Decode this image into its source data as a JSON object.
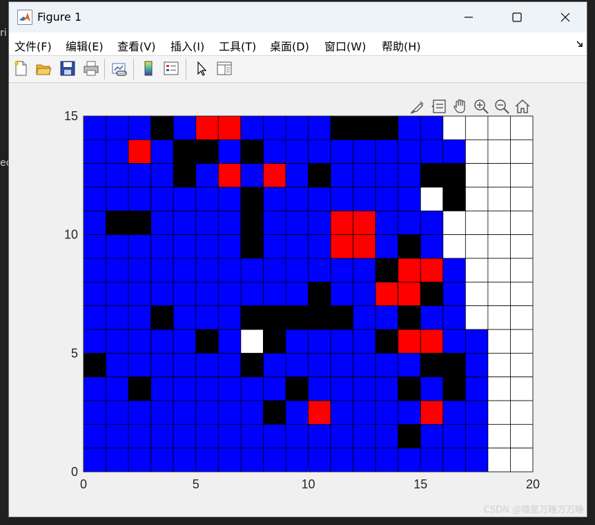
{
  "window": {
    "title": "Figure 1",
    "side_text_1": "ri",
    "side_text_2": "ec"
  },
  "menu": [
    {
      "label": "文件(F)"
    },
    {
      "label": "编辑(E)"
    },
    {
      "label": "查看(V)"
    },
    {
      "label": "插入(I)"
    },
    {
      "label": "工具(T)"
    },
    {
      "label": "桌面(D)"
    },
    {
      "label": "窗口(W)"
    },
    {
      "label": "帮助(H)"
    }
  ],
  "toolbar": [
    "new-figure-icon",
    "open-file-icon",
    "save-icon",
    "print-icon",
    "link-plot-icon",
    "colorbar-icon",
    "legend-icon",
    "pointer-icon",
    "property-inspector-icon"
  ],
  "axes_toolbar": [
    "brush-icon",
    "data-tips-icon",
    "pan-hand-icon",
    "zoom-in-icon",
    "zoom-out-icon",
    "home-icon"
  ],
  "colors": {
    "blue": "#0000ff",
    "black": "#000000",
    "red": "#ff0000",
    "white": "#ffffff",
    "grid": "#000000"
  },
  "chart_data": {
    "type": "heatmap",
    "xlim": [
      0,
      20
    ],
    "ylim": [
      0,
      15
    ],
    "xticks": [
      "0",
      "5",
      "10",
      "15",
      "20"
    ],
    "yticks": [
      "0",
      "5",
      "10",
      "15"
    ],
    "cell_size": 1,
    "legend_codes": {
      "B": "blue",
      "K": "black",
      "R": "red",
      "W": "white"
    },
    "rows_top_to_bottom": [
      "BBBKBRRBBBBKKKBBWWWW",
      "BBRBKKBKBBBBBBBBBWWW",
      "BBBBKBRBRBKBBBBKKWWW",
      "BBBBBBBKBBBBBBBWKWWW",
      "BKKBBBBKBBBRRBBBWWWW",
      "BBBBBBBKBBBRRBKBWWWW",
      "BBBBBBBBBBBBBKRRBWWW",
      "BBBBBBBBBBKBBRRKBWWW",
      "BBBKBBBKKKKKBBKBBWWW",
      "BBBBBKBWKBBBBKRRBBWW",
      "KBBBBBBKBBBBBBBKKBWW",
      "BBKBBBBBBKBBBBKBKBWW",
      "BBBBBBBBKBRBBBBRBBWW",
      "BBBBBBBBBBBBBBKBBBWW",
      "BBBBBBBBBBBBBBBBBBWW"
    ]
  },
  "watermark": "CSDN @嘻星万睡万万睡"
}
